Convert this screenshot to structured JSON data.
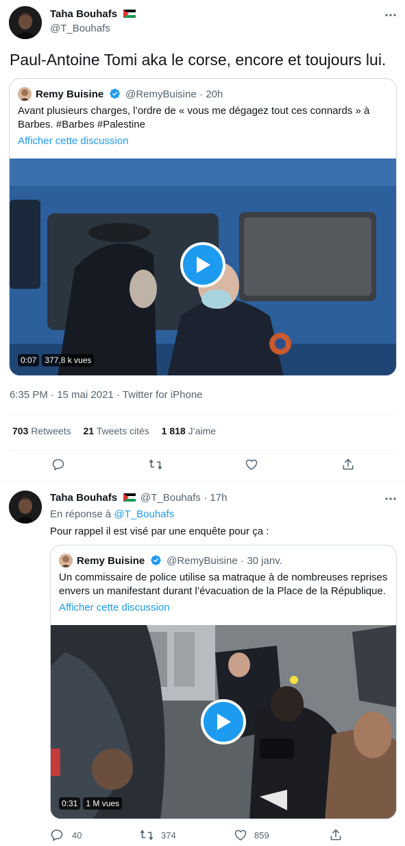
{
  "tweet1": {
    "author_name": "Taha Bouhafs",
    "author_handle": "@T_Bouhafs",
    "text": "Paul-Antoine Tomi aka le corse, encore et toujours lui.",
    "quote": {
      "author_name": "Remy Buisine",
      "author_handle": "@RemyBuisine",
      "time": "· 20h",
      "text": "Avant plusieurs charges, l’ordre de « vous me dégagez tout ces connards » à Barbes. #Barbes #Palestine",
      "show_thread": "Afficher cette discussion",
      "video_duration": "0:07",
      "video_views": "377,8 k vues"
    },
    "meta": "6:35 PM · 15 mai 2021 · Twitter for iPhone",
    "stats": {
      "retweets_count": "703",
      "retweets_label": "Retweets",
      "quotes_count": "21",
      "quotes_label": "Tweets cités",
      "likes_count": "1 818",
      "likes_label": "J’aime"
    }
  },
  "tweet2": {
    "author_name": "Taha Bouhafs",
    "author_handle": "@T_Bouhafs",
    "time": "· 17h",
    "reply_prefix": "En réponse à",
    "reply_to": "@T_Bouhafs",
    "text": "Pour rappel il est visé par une enquête pour ça :",
    "quote": {
      "author_name": "Remy Buisine",
      "author_handle": "@RemyBuisine",
      "time": "· 30 janv.",
      "text": "Un commissaire de police utilise sa matraque à de nombreuses reprises envers un manifestant durant l’évacuation de la Place de la République.",
      "show_thread": "Afficher cette discussion",
      "video_duration": "0:31",
      "video_views": "1 M vues"
    },
    "actions": {
      "replies": "40",
      "retweets": "374",
      "likes": "859"
    }
  },
  "colors": {
    "accent": "#1d9bf0",
    "text_primary": "#0f1419",
    "text_secondary": "#536471",
    "border": "#cfd9de"
  },
  "icons": [
    "more-icon",
    "verified-icon",
    "palestine-flag-icon",
    "reply-icon",
    "retweet-icon",
    "like-icon",
    "share-icon",
    "play-icon"
  ]
}
